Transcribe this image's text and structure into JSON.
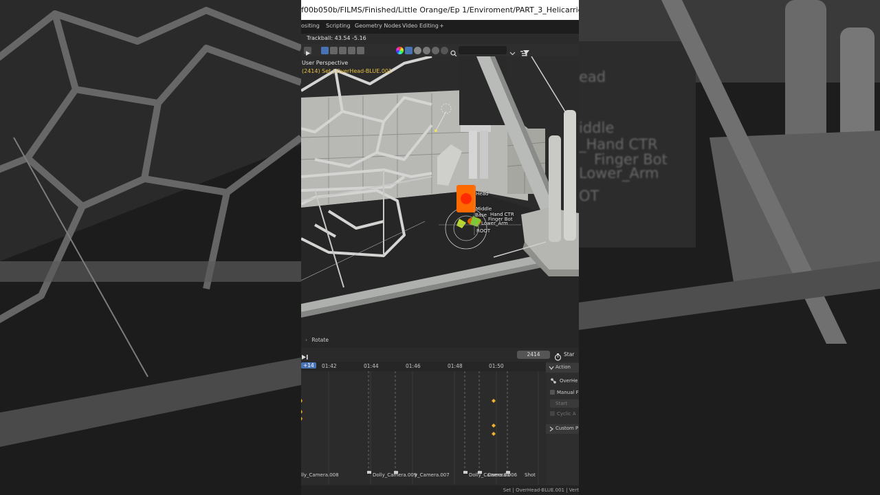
{
  "window": {
    "title": "f00b050b/FILMS/Finished/Little Orange/Ep 1/Enviroment/PART_3_Helicarrier_INT.blend]"
  },
  "workspace_tabs": [
    "ositing",
    "Scripting",
    "Geometry Nodes",
    "Video Editing",
    "+"
  ],
  "viewport": {
    "trackball": "Trackball: 43.54 -5.16",
    "mode_label": "User Perspective",
    "object_label": "(2414) Set | OverHead-BLUE.001",
    "bones": [
      "Head",
      "Middle",
      "Base",
      "Hand CTR",
      "Finger Bot",
      "Lower_Arm",
      "ROOT"
    ],
    "operator_panel": "Rotate"
  },
  "blurred_right": [
    "ead",
    "iddle",
    "_Hand CTR",
    "Finger Bot",
    "Lower_Arm",
    "OT"
  ],
  "timeline": {
    "current_frame": "2414",
    "current_frame_badge": "+14",
    "start_label": "Star",
    "ticks": [
      "01:42",
      "01:44",
      "01:46",
      "01:48",
      "01:50"
    ],
    "markers": [
      "lly_Camera.008",
      "Dolly_Camera.009",
      "y_Camera.007",
      "Dolly_Camera.00",
      "Camera.006",
      "Shot"
    ]
  },
  "side_panel": {
    "section": "Action",
    "action_name": "OverHe",
    "manual_frame": "Manual F",
    "start": "Start",
    "cyclic": "Cyclic A",
    "custom": "Custom P"
  },
  "status_bar": "Set | OverHead-BLUE.001 | Vert",
  "colors": {
    "accent": "#4772b3",
    "bone_active": "#ff6a00",
    "keyframe": "#f0b030",
    "text_yellow": "#e8c040"
  }
}
